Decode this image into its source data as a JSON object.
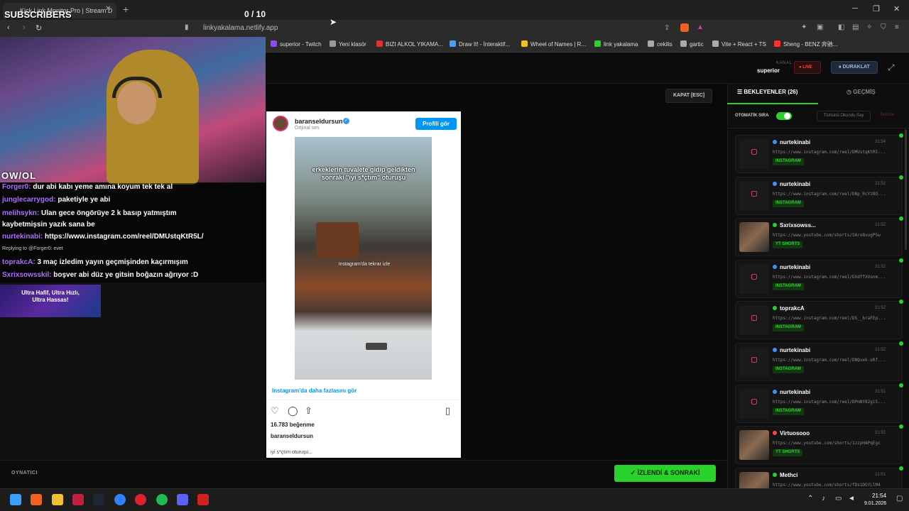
{
  "browser": {
    "tab_title": "Kick Link Monitor Pro | Stream D",
    "url": "linkyakalama.netlify.app",
    "bookmarks": [
      {
        "label": "superior - Twitch",
        "color": "#9146ff"
      },
      {
        "label": "Yeni klasör",
        "color": "#999999"
      },
      {
        "label": "BIZI ALKOL YIKAMA...",
        "color": "#e03030"
      },
      {
        "label": "Draw It! - İnteraktif...",
        "color": "#40a0ff"
      },
      {
        "label": "Wheel of Names | R...",
        "color": "#f0c020"
      },
      {
        "label": "link yakalama",
        "color": "#2bd12b"
      },
      {
        "label": "cekilis",
        "color": "#aaaaaa"
      },
      {
        "label": "gartic",
        "color": "#aaaaaa"
      },
      {
        "label": "Vite + React + TS",
        "color": "#aaaaaa"
      },
      {
        "label": "Sheng - BENZ 奔驰...",
        "color": "#ff3030"
      }
    ]
  },
  "header": {
    "kanal_label": "KANAL",
    "kanal_value": "superior",
    "live_label": "LIVE",
    "pause_label": "DURAKLAT"
  },
  "viewer": {
    "close_label": "KAPAT [ESC]",
    "footer_label": "OYNATICI",
    "next_label": "İZLENDİ & SONRAKİ",
    "embed": {
      "username": "baranseldursun",
      "subtitle": "Orijinal ses",
      "profile_button": "Profili gör",
      "video_caption": "erkeklerin tuvalete gidip geldikten sonraki \"iyi s*çtım\" oturuşu",
      "video_overlay": "Instagram'da tekrar izle",
      "more_link": "Instagram'da daha fazlasını gör",
      "likes": "16.783 beğenme",
      "username_footer": "baranseldursun",
      "description": "iyi s*çtım oturuşu..."
    }
  },
  "queue": {
    "tab_queue": "BEKLEYENLER (26)",
    "tab_history": "GEÇMİŞ",
    "auto_label": "OTOMATİK SIRA",
    "mark_all": "Tümünü Okundu Say",
    "clear": "Temizle",
    "items": [
      {
        "user": "nurtekinabi",
        "time": "21:54",
        "url": "https://www.instagram.com/reel/DMUstqKtR5...",
        "badge": "INSTAGRAM",
        "type": "ig",
        "dot": "#3897f0"
      },
      {
        "user": "nurtekinabi",
        "time": "21:52",
        "url": "https://www.instagram.com/reel/DNp_RcYzBQ...",
        "badge": "INSTAGRAM",
        "type": "ig",
        "dot": "#3897f0"
      },
      {
        "user": "Sxrixsowss...",
        "time": "21:52",
        "url": "https://www.youtube.com/shorts/SAro8vugP5w",
        "badge": "YT SHORTS",
        "type": "yt",
        "dot": "#2bd12b"
      },
      {
        "user": "nurtekinabi",
        "time": "21:52",
        "url": "https://www.instagram.com/reel/DXdffXVonm...",
        "badge": "INSTAGRAM",
        "type": "ig",
        "dot": "#3897f0"
      },
      {
        "user": "toprakcA",
        "time": "21:52",
        "url": "https://www.instagram.com/reel/DS__braFEp...",
        "badge": "INSTAGRAM",
        "type": "ig",
        "dot": "#2bd12b"
      },
      {
        "user": "nurtekinabi",
        "time": "21:52",
        "url": "https://www.instagram.com/reel/DNQvek-oRf...",
        "badge": "INSTAGRAM",
        "type": "ig",
        "dot": "#3897f0"
      },
      {
        "user": "nurtekinabi",
        "time": "21:51",
        "url": "https://www.instagram.com/reel/DPmNY82gi5...",
        "badge": "INSTAGRAM",
        "type": "ig",
        "dot": "#3897f0"
      },
      {
        "user": "Virtuosooo",
        "time": "21:51",
        "url": "https://www.youtube.com/shorts/1zzpHAPqEgc",
        "badge": "YT SHORTS",
        "type": "yt",
        "dot": "#ff4444"
      },
      {
        "user": "Methci",
        "time": "21:51",
        "url": "https://www.youtube.com/shorts/fDs1DGYLlM4",
        "badge": "YT SHORTS",
        "type": "yt",
        "dot": "#2bd12b"
      }
    ]
  },
  "stream": {
    "subs_title": "SUBSCRIBERS",
    "subs_count": "0  / 10",
    "logo": "OW/OL",
    "ad_text": "Ultra Hafif, Ultra Hızlı, Ultra Hassas!",
    "chat": [
      {
        "nick": "Forger0:",
        "msg": "dur abi kabı yeme amına koyum tek tek al"
      },
      {
        "nick": "junglecarrygod:",
        "msg": "paketiyle ye abi"
      },
      {
        "nick": "melihsykn:",
        "msg": "Ulan gece öngörüye 2 k basıp yatmıştım"
      },
      {
        "nick": "",
        "msg": "kaybetmişsin yazık sana be"
      },
      {
        "nick": "nurtekinabi:",
        "msg": "https://www.instagram.com/reel/DMUstqKtR5L/"
      },
      {
        "nick": "",
        "msg": "Replying to @Forger0: evet"
      },
      {
        "nick": "toprakcA:",
        "msg": "3 maç izledim yayın geçmişinden kaçırmışım"
      },
      {
        "nick": "Sxrixsowsskil:",
        "msg": "boşver abi düz ye gitsin boğazın ağrıyor :D"
      }
    ]
  },
  "taskbar": {
    "time": "21:54",
    "date": "9.01.2026"
  }
}
